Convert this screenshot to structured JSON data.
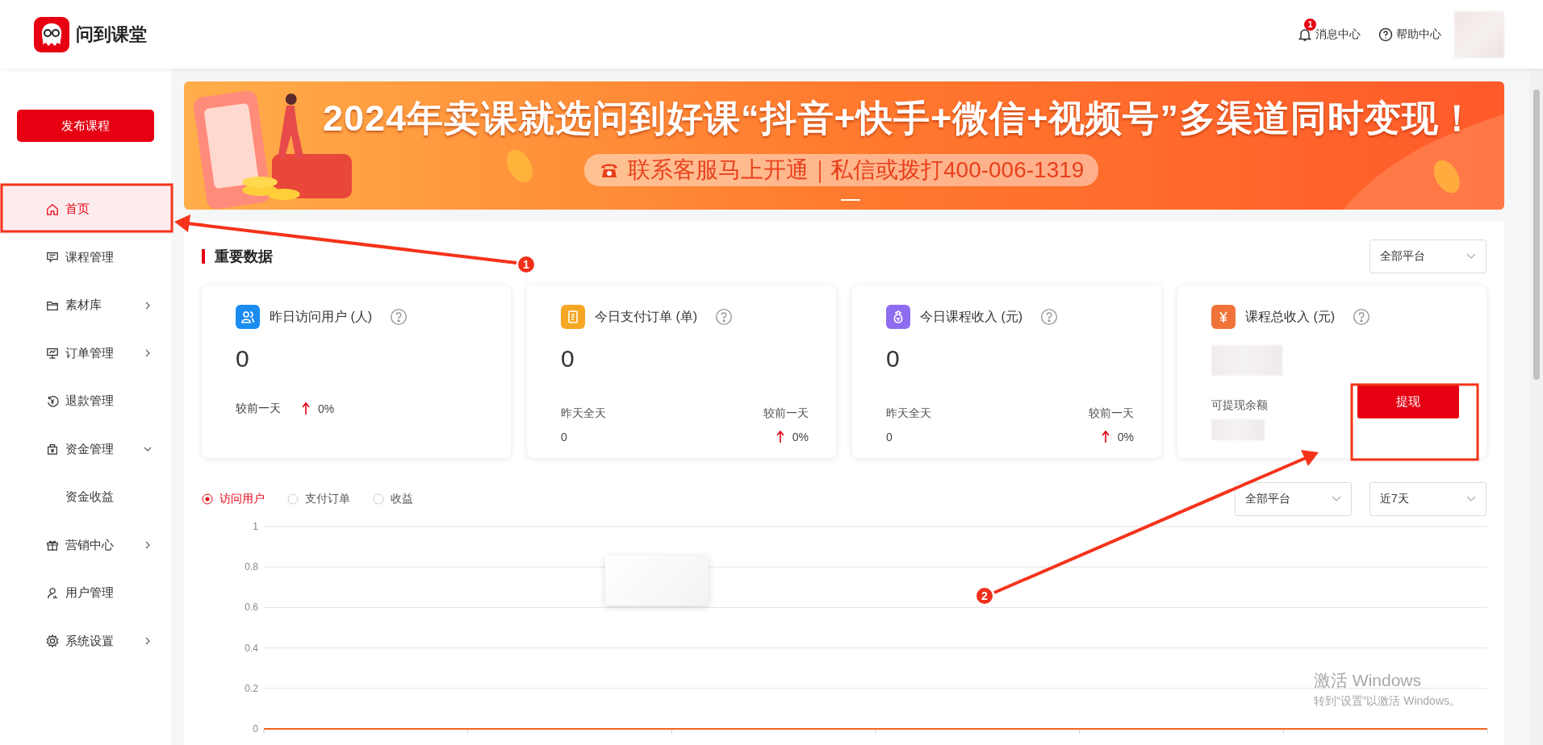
{
  "header": {
    "logo_text": "问到课堂",
    "messages": {
      "label": "消息中心",
      "badge": "1"
    },
    "help": {
      "label": "帮助中心"
    }
  },
  "sidebar": {
    "publish_button": "发布课程",
    "items": [
      {
        "label": "首页",
        "kind": "link",
        "selected": true
      },
      {
        "label": "课程管理",
        "kind": "link",
        "selected": false
      },
      {
        "label": "素材库",
        "kind": "group",
        "expanded": false,
        "selected": false
      },
      {
        "label": "订单管理",
        "kind": "group",
        "expanded": false,
        "selected": false
      },
      {
        "label": "退款管理",
        "kind": "link",
        "selected": false
      },
      {
        "label": "资金管理",
        "kind": "group",
        "expanded": true,
        "selected": false,
        "children": [
          {
            "label": "资金收益",
            "selected": false
          }
        ]
      },
      {
        "label": "营销中心",
        "kind": "group",
        "expanded": false,
        "selected": false
      },
      {
        "label": "用户管理",
        "kind": "link",
        "selected": false
      },
      {
        "label": "系统设置",
        "kind": "group",
        "expanded": false,
        "selected": false
      }
    ]
  },
  "banner": {
    "kind": "picture",
    "headline": "2024年卖课就选问到好课“抖音+快手+微信+视频号”多渠道同时变现！",
    "subline": "联系客服马上开通｜私信或拨打400-006-1319"
  },
  "section": {
    "title": "重要数据",
    "platform_filter": "全部平台"
  },
  "cards": [
    {
      "kind": "compare",
      "title": "昨日访问用户 (人)",
      "color": "#1a8cf0",
      "value": "0",
      "compare_label": "较前一天",
      "compare_value": "0%"
    },
    {
      "kind": "daily",
      "title": "今日支付订单 (单)",
      "color": "#f5a623",
      "value": "0",
      "yesterday_label": "昨天全天",
      "yesterday_value": "0",
      "compare_label": "较前一天",
      "compare_value": "0%"
    },
    {
      "kind": "daily",
      "title": "今日课程收入 (元)",
      "color": "#8e6cf0",
      "value": "0",
      "yesterday_label": "昨天全天",
      "yesterday_value": "0",
      "compare_label": "较前一天",
      "compare_value": "0%"
    },
    {
      "kind": "total",
      "title": "课程总收入 (元)",
      "color": "#f0743a",
      "balance_label": "可提现余额",
      "button": "提现"
    }
  ],
  "chart_tabs": [
    {
      "label": "访问用户",
      "selected": true
    },
    {
      "label": "支付订单",
      "selected": false
    },
    {
      "label": "收益",
      "selected": false
    }
  ],
  "chart_filters": [
    "全部平台",
    "近7天"
  ],
  "chart": {
    "chart_data": {
      "type": "line",
      "grid": true,
      "ylim": [
        0,
        1
      ],
      "yticks": [
        0,
        0.2,
        0.4,
        0.6,
        0.8,
        1
      ],
      "series": [
        {
          "color": "#f26522",
          "values": [
            0,
            0,
            0,
            0,
            0,
            0,
            0
          ]
        }
      ]
    }
  },
  "annotations": [
    {
      "number": "1"
    },
    {
      "number": "2"
    }
  ],
  "os_notice": {
    "title": "激活 Windows",
    "subtitle": "转到“设置”以激活 Windows。"
  }
}
